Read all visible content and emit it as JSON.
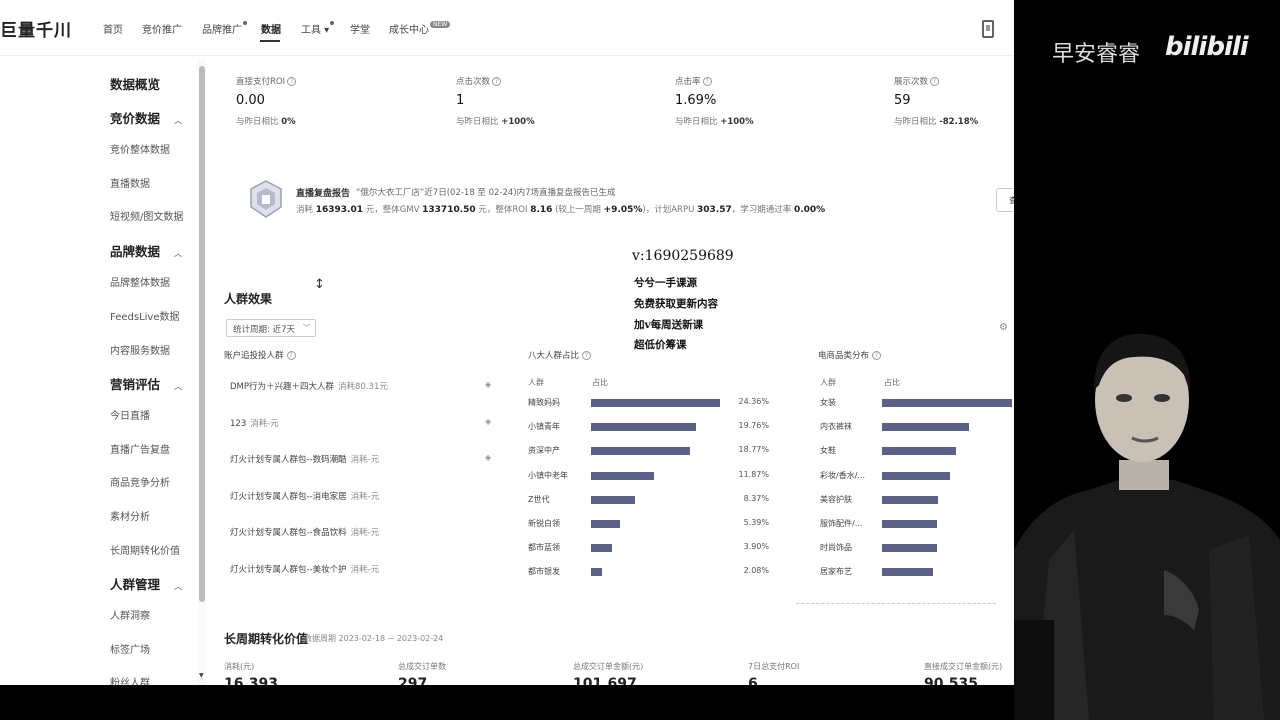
{
  "app": {
    "logo": "巨量千川"
  },
  "nav": {
    "items": [
      {
        "label": "首页"
      },
      {
        "label": "竞价推广"
      },
      {
        "label": "品牌推广"
      },
      {
        "label": "数据"
      },
      {
        "label": "工具 ▾"
      },
      {
        "label": "学堂"
      },
      {
        "label": "成长中心"
      }
    ],
    "new_badge": "NEW"
  },
  "sidebar": {
    "overview": "数据概览",
    "bid_data": {
      "head": "竞价数据",
      "items": [
        "竞价整体数据",
        "直播数据",
        "短视频/图文数据"
      ]
    },
    "brand_data": {
      "head": "品牌数据",
      "items": [
        "品牌整体数据",
        "FeedsLive数据",
        "内容服务数据"
      ]
    },
    "marketing": {
      "head": "营销评估",
      "items": [
        "今日直播",
        "直播广告复盘",
        "商品竞争分析",
        "素材分析",
        "长周期转化价值"
      ]
    },
    "crowd": {
      "head": "人群管理",
      "items": [
        "人群洞察",
        "标签广场",
        "粉丝人群"
      ]
    }
  },
  "metrics": [
    {
      "label": "直接支付ROI",
      "value": "0.00",
      "compare_label": "与昨日相比",
      "compare_value": "0%"
    },
    {
      "label": "点击次数",
      "value": "1",
      "compare_label": "与昨日相比",
      "compare_value": "+100%"
    },
    {
      "label": "点击率",
      "value": "1.69%",
      "compare_label": "与昨日相比",
      "compare_value": "+100%"
    },
    {
      "label": "展示次数",
      "value": "59",
      "compare_label": "与昨日相比",
      "compare_value": "-82.18%"
    }
  ],
  "report": {
    "title": "直播复盘报告",
    "subtitle": "“俄尔大衣工厂店”近7日(02-18 至 02-24)内7场直播复盘报告已生成",
    "stats_prefix": "消耗",
    "cost": "16393.01",
    "gmv_label": "元，整体GMV",
    "gmv": "133710.50",
    "roi_label": "元，整体ROI",
    "roi": "8.16",
    "roi_change_label": "(较上一周期",
    "roi_change": "+9.05%",
    "arpu_label": ")，计划ARPU",
    "arpu": "303.57",
    "learn_label": "，学习期通过率",
    "learn": "0.00%",
    "button": "查"
  },
  "overlay": {
    "contact": "v:1690259689",
    "lines": [
      "兮兮一手课源",
      "免费获取更新内容",
      "加v每周送新课",
      "超低价筹课"
    ]
  },
  "crowd": {
    "title": "人群效果",
    "period_select": "统计周期: 近7天",
    "packages_title": "账户追投投人群",
    "packages": [
      {
        "name": "DMP行为＋兴趣＋四大人群",
        "cost": "消耗80.31元"
      },
      {
        "name": "123",
        "cost": "消耗-元"
      },
      {
        "name": "灯火计划专属人群包--数码潮酷",
        "cost": "消耗-元"
      },
      {
        "name": "灯火计划专属人群包--消电家居",
        "cost": "消耗-元"
      },
      {
        "name": "灯火计划专属人群包--食品饮料",
        "cost": "消耗-元"
      },
      {
        "name": "灯火计划专属人群包--美妆个护",
        "cost": "消耗-元"
      }
    ],
    "eight_title": "八大人群占比",
    "eight_headers": [
      "人群",
      "占比"
    ],
    "eight": [
      {
        "name": "精致妈妈",
        "pct": "24.36%",
        "value": 24.36
      },
      {
        "name": "小镇青年",
        "pct": "19.76%",
        "value": 19.76
      },
      {
        "name": "资深中产",
        "pct": "18.77%",
        "value": 18.77
      },
      {
        "name": "小镇中老年",
        "pct": "11.87%",
        "value": 11.87
      },
      {
        "name": "Z世代",
        "pct": "8.37%",
        "value": 8.37
      },
      {
        "name": "新锐白领",
        "pct": "5.39%",
        "value": 5.39
      },
      {
        "name": "都市蓝领",
        "pct": "3.90%",
        "value": 3.9
      },
      {
        "name": "都市银发",
        "pct": "2.08%",
        "value": 2.08
      }
    ],
    "ecom_title": "电商品类分布",
    "ecom_headers": [
      "人群",
      "占比"
    ],
    "ecom": [
      {
        "name": "女装",
        "value": 100
      },
      {
        "name": "内衣裤袜",
        "value": 67
      },
      {
        "name": "女鞋",
        "value": 57
      },
      {
        "name": "彩妆/香水/...",
        "value": 52
      },
      {
        "name": "美容护肤",
        "value": 43
      },
      {
        "name": "服饰配件/...",
        "value": 42
      },
      {
        "name": "时尚饰品",
        "value": 42
      },
      {
        "name": "居家布艺",
        "value": 39
      }
    ]
  },
  "lifecycle": {
    "title": "长周期转化价值",
    "period": "数据周期 2023-02-18 ~ 2023-02-24",
    "kpis": [
      {
        "label": "消耗(元)",
        "value": "16,393"
      },
      {
        "label": "总成交订单数",
        "value": "297"
      },
      {
        "label": "总成交订单金额(元)",
        "value": "101,697"
      },
      {
        "label": "7日总支付ROI",
        "value": "6"
      },
      {
        "label": "直接成交订单金额(元)",
        "value": "90,535"
      }
    ]
  },
  "watermark": {
    "text": "早安睿睿",
    "logo": "bilibili"
  },
  "colors": {
    "bar": "#5c6287",
    "background": "#ffffff",
    "outer": "#000000"
  }
}
